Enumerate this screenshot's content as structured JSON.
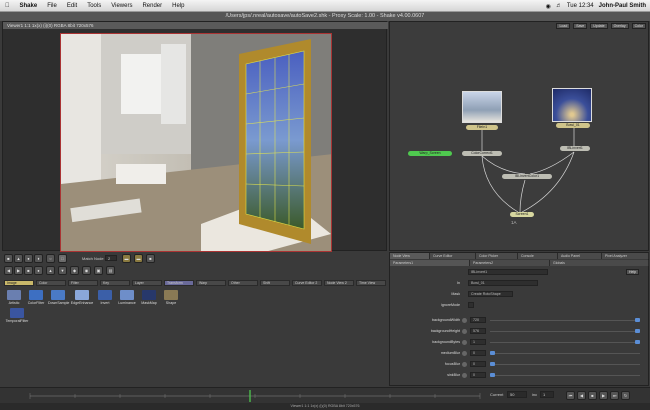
{
  "menubar": {
    "app": "Shake",
    "items": [
      "File",
      "Edit",
      "Tools",
      "Viewers",
      "Render",
      "Help"
    ],
    "clock": "Tue 12:34",
    "user": "John-Paul Smith"
  },
  "window_title": "/Users/jps/.nreal/autosave/autoSave2.shk - Proxy Scale: 1.00 - Shake v4.00.0607",
  "viewer": {
    "header": "Viewer1 1:1 1x(x) (i)(0) RGBA 8bit 720x576"
  },
  "nodeview": {
    "toolbar": [
      "Load",
      "Save",
      "Update",
      "Overlay",
      "Color"
    ],
    "nodes": [
      {
        "label": "FileIn1",
        "kind": "file"
      },
      {
        "label": "Bowl_01",
        "kind": "file"
      },
      {
        "label": "Warp_Screen",
        "kind": "select"
      },
      {
        "label": "ColorCorrect1",
        "kind": "normal"
      },
      {
        "label": "IBLinvert1",
        "kind": "normal"
      },
      {
        "label": "IBLinvertColor1",
        "kind": "normal"
      },
      {
        "label": "Screen1",
        "kind": "normal"
      },
      {
        "label": "1A",
        "kind": "label"
      }
    ]
  },
  "tool_tabs": [
    "Image",
    "Color",
    "Filter",
    "Key",
    "Layer",
    "Transform",
    "Warp",
    "Other",
    "Shift",
    "Curve Editor 2",
    "Node View 2",
    "Time View"
  ],
  "active_tab": "Image",
  "tools": [
    {
      "label": "Artistic",
      "color": "#6a7fb0"
    },
    {
      "label": "ColorFilter",
      "color": "#3d6fc2"
    },
    {
      "label": "DownSample",
      "color": "#4a7ac5"
    },
    {
      "label": "EdgeEnhance",
      "color": "#8aa7d9"
    },
    {
      "label": "Invert",
      "color": "#3b5fa8"
    },
    {
      "label": "Luminance",
      "color": "#6e8ec9"
    },
    {
      "label": "MaskMap",
      "color": "#27386b"
    },
    {
      "label": "Shape",
      "color": "#8a7a55"
    },
    {
      "label": "TemporalFilter",
      "color": "#3a55a0"
    }
  ],
  "match_bar": {
    "label": "Match Node",
    "value": "2"
  },
  "param_tabs": [
    "Node View",
    "Curve Editor",
    "Color Picker",
    "Console",
    "Audio Panel",
    "Pixel Analyzer"
  ],
  "param_subtabs": [
    "Parameters1",
    "Parameters2",
    "Globals"
  ],
  "params": {
    "header": "IBLinvert1",
    "help": "Help",
    "rows": [
      {
        "label": "In",
        "value": "Bowl_01"
      },
      {
        "label": "Mask",
        "value": "Create  RotoShape"
      },
      {
        "label": "ignoreMode",
        "value": ""
      },
      {
        "label": "backgroundWidth",
        "value": "720",
        "level": 1.0
      },
      {
        "label": "backgroundHeight",
        "value": "576",
        "level": 1.0
      },
      {
        "label": "backgroundBytes",
        "value": "1",
        "level": 1.0
      },
      {
        "label": "mediumBlur",
        "value": "0",
        "level": 0.0
      },
      {
        "label": "focusBlur",
        "value": "0",
        "level": 0.0
      },
      {
        "label": "sinkBlur",
        "value": "0",
        "level": 0.0
      }
    ]
  },
  "timeline": {
    "current_label": "Current",
    "current": "50",
    "inc_label": "inc",
    "inc": "1"
  },
  "status": "Viewer1 1:1 1x(x) (i)(0) RGBA 8bit 720x576"
}
